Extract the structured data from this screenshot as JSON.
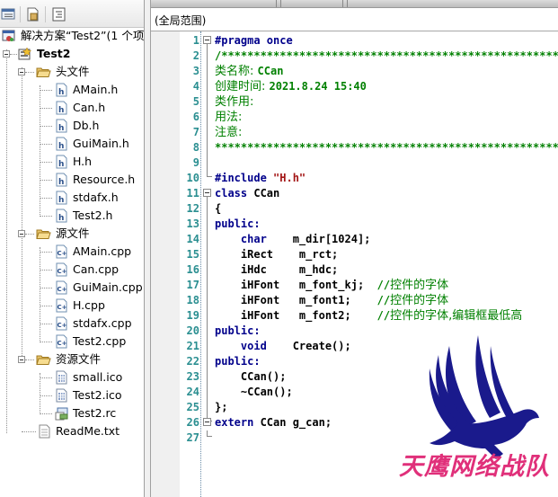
{
  "solution_explorer": {
    "toolbar": [
      {
        "icon": "solution-explorer-icon"
      },
      {
        "icon": "properties-icon"
      },
      {
        "icon": "class-view-icon"
      }
    ],
    "solution_label": "解决方案“Test2”(1 个项",
    "project_label": "Test2",
    "folders": [
      {
        "label": "头文件",
        "files": [
          "AMain.h",
          "Can.h",
          "Db.h",
          "GuiMain.h",
          "H.h",
          "Resource.h",
          "stdafx.h",
          "Test2.h"
        ],
        "file_icon": "header-file-icon"
      },
      {
        "label": "源文件",
        "files": [
          "AMain.cpp",
          "Can.cpp",
          "GuiMain.cpp",
          "H.cpp",
          "stdafx.cpp",
          "Test2.cpp"
        ],
        "file_icon": "cpp-file-icon"
      },
      {
        "label": "资源文件",
        "files": [
          "small.ico",
          "Test2.ico",
          "Test2.rc"
        ],
        "file_icon": "resource-file-icon"
      }
    ],
    "extra_file": "ReadMe.txt"
  },
  "editor": {
    "scope_label": "(全局范围)",
    "line_numbers": [
      "1",
      "2",
      "3",
      "4",
      "5",
      "6",
      "7",
      "8",
      "9",
      "10",
      "11",
      "12",
      "13",
      "14",
      "15",
      "16",
      "17",
      "18",
      "19",
      "20",
      "21",
      "22",
      "23",
      "24",
      "25",
      "26",
      "27"
    ],
    "lines": {
      "l1": {
        "kw": "#pragma once"
      },
      "l2": {
        "cm": "/*******************************************************"
      },
      "l3": {
        "cmz": "类名称: ",
        "cm": "CCan"
      },
      "l4": {
        "cmz": "创建时间: ",
        "cm": "2021.8.24 15:40"
      },
      "l5": {
        "cmz": "类作用:"
      },
      "l6": {
        "cmz": "用法:"
      },
      "l7": {
        "cmz": "注意:"
      },
      "l8": {
        "cm": "*******************************************************"
      },
      "l10": {
        "kw": "#include ",
        "st": "\"H.h\""
      },
      "l11": {
        "kw": "class ",
        "tx": "CCan"
      },
      "l12": {
        "tx": "{"
      },
      "l13": {
        "kw": "public:"
      },
      "l14": {
        "kw": "    char",
        "tx": "    m_dir[1024];"
      },
      "l15": {
        "tx": "    iRect    m_rct;"
      },
      "l16": {
        "tx": "    iHdc     m_hdc;"
      },
      "l17": {
        "tx": "    iHFont   m_font_kj;  ",
        "cm": "//",
        "cmz": "控件的字体"
      },
      "l18": {
        "tx": "    iHFont   m_font1;    ",
        "cm": "//",
        "cmz": "控件的字体"
      },
      "l19": {
        "tx": "    iHFont   m_font2;    ",
        "cm": "//",
        "cmz": "控件的字体,编辑框最低高"
      },
      "l20": {
        "kw": "public:"
      },
      "l21": {
        "kw": "    void",
        "tx": "    Create();"
      },
      "l22": {
        "kw": "public:"
      },
      "l23": {
        "tx": "    CCan();"
      },
      "l24": {
        "tx": "    ~CCan();"
      },
      "l25": {
        "tx": "};"
      },
      "l26": {
        "kw": "extern ",
        "tx": "CCan g_can;"
      }
    }
  },
  "watermark": {
    "text": "天鹰网络战队",
    "icon": "eagle-logo-icon",
    "eagle_color": "#1a1a8c",
    "text_color": "#e0307a"
  }
}
